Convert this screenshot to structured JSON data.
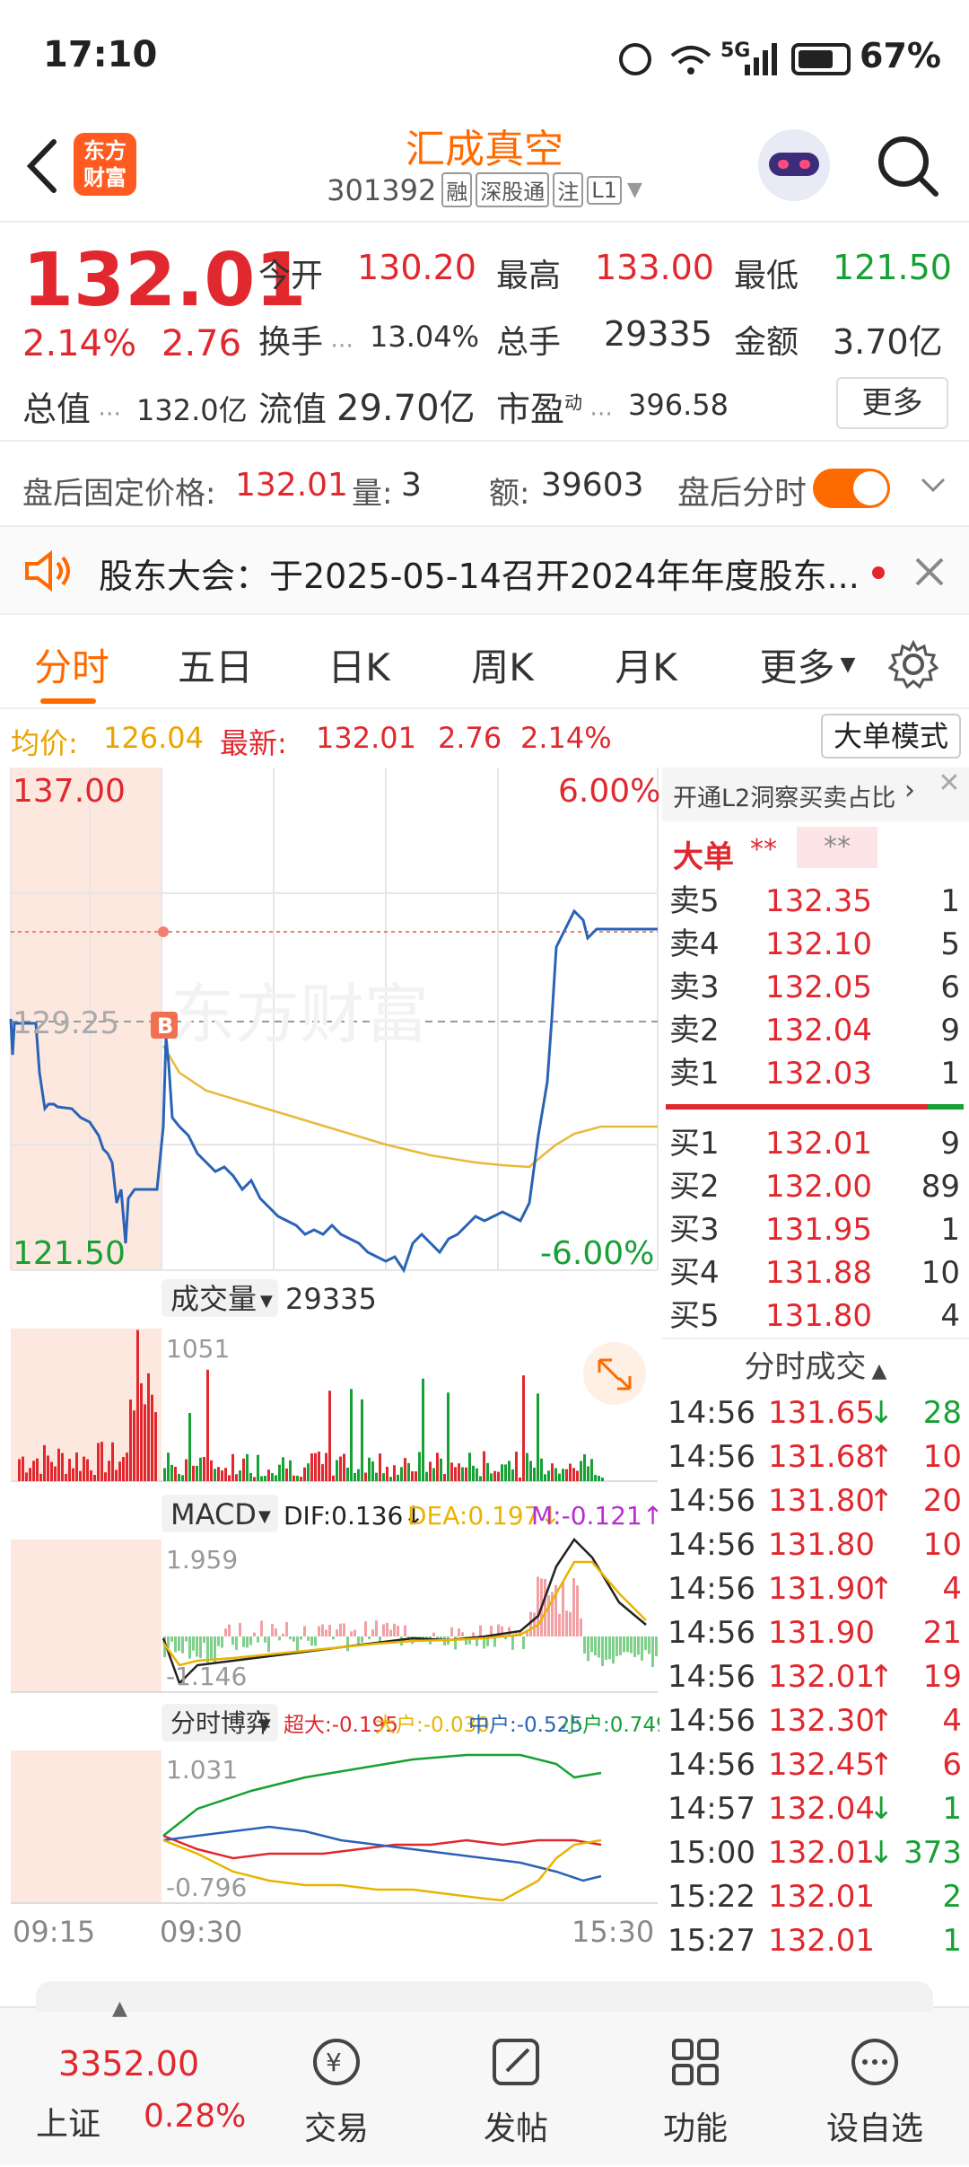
{
  "status_bar": {
    "time": "17:10",
    "battery": "67%",
    "network": "5G"
  },
  "header": {
    "stock_name": "汇成真空",
    "stock_code": "301392",
    "tags": [
      "融",
      "深股通",
      "注",
      "L1"
    ],
    "logo_text": "东方财富",
    "icons": [
      "back-arrow-icon",
      "robot-avatar-icon",
      "search-icon"
    ]
  },
  "quote": {
    "price": "132.01",
    "change_pct": "2.14%",
    "change": "2.76",
    "open_label": "今开",
    "open": "130.20",
    "high_label": "最高",
    "high": "133.00",
    "low_label": "最低",
    "low": "121.50",
    "turnover_label": "换手",
    "turnover": "13.04%",
    "volume_label": "总手",
    "volume": "29335",
    "amount_label": "金额",
    "amount": "3.70亿",
    "mktcap_label": "总值",
    "mktcap": "132.0亿",
    "float_label": "流值",
    "float": "29.70亿",
    "pe_label": "市盈",
    "pe_sup": "动",
    "pe": "396.58",
    "more_label": "更多"
  },
  "after_hours": {
    "price_label": "盘后固定价格:",
    "price": "132.01",
    "qty_label": "量:",
    "qty": "3",
    "amount_label": "额:",
    "amount": "39603",
    "toggle_label": "盘后分时"
  },
  "notice": {
    "text": "股东大会：于2025-05-14召开2024年年度股东..."
  },
  "tabs": [
    "分时",
    "五日",
    "日K",
    "周K",
    "月K",
    "更多"
  ],
  "info_bar": {
    "avg_label": "均价:",
    "avg": "126.04",
    "latest_label": "最新:",
    "latest": "132.01",
    "change": "2.76",
    "change_pct": "2.14%",
    "mode_button": "大单模式"
  },
  "price_chart": {
    "y_top": "137.00",
    "y_mid": "129.25",
    "y_bottom": "121.50",
    "pct_top": "6.00%",
    "pct_bottom": "-6.00%",
    "watermark": "东方财富",
    "marker": "B"
  },
  "volume_panel": {
    "label": "成交量",
    "total": "29335",
    "max": "1051"
  },
  "macd_panel": {
    "label": "MACD",
    "dif": "DIF:0.136↓",
    "dea": "DEA:0.197↓",
    "m": "M:-0.121↑",
    "max": "1.959",
    "min": "-1.146"
  },
  "game_panel": {
    "label": "分时博弈",
    "super": "超大:-0.195",
    "big": "大户:-0.030",
    "mid": "中户:-0.525",
    "small": "小户:0.749",
    "max": "1.031",
    "min": "-0.796"
  },
  "time_axis": {
    "t0": "09:15",
    "t1": "09:30",
    "t2": "15:30"
  },
  "orderbook": {
    "l2_text": "开通L2洞察买卖占比",
    "big_label": "大单",
    "masked": "**",
    "masked2": "**",
    "asks": [
      {
        "label": "卖5",
        "price": "132.35",
        "qty": "1"
      },
      {
        "label": "卖4",
        "price": "132.10",
        "qty": "5"
      },
      {
        "label": "卖3",
        "price": "132.05",
        "qty": "6"
      },
      {
        "label": "卖2",
        "price": "132.04",
        "qty": "9"
      },
      {
        "label": "卖1",
        "price": "132.03",
        "qty": "1"
      }
    ],
    "bids": [
      {
        "label": "买1",
        "price": "132.01",
        "qty": "9"
      },
      {
        "label": "买2",
        "price": "132.00",
        "qty": "89"
      },
      {
        "label": "买3",
        "price": "131.95",
        "qty": "1"
      },
      {
        "label": "买4",
        "price": "131.88",
        "qty": "10"
      },
      {
        "label": "买5",
        "price": "131.80",
        "qty": "4"
      }
    ],
    "trades_title": "分时成交",
    "trades": [
      {
        "time": "14:56",
        "price": "131.65",
        "dir": "↓",
        "qty": "28",
        "color": "#e0282e",
        "qcolor": "#17a034"
      },
      {
        "time": "14:56",
        "price": "131.68",
        "dir": "↑",
        "qty": "10",
        "color": "#e0282e",
        "qcolor": "#e0282e"
      },
      {
        "time": "14:56",
        "price": "131.80",
        "dir": "↑",
        "qty": "20",
        "color": "#e0282e",
        "qcolor": "#e0282e"
      },
      {
        "time": "14:56",
        "price": "131.80",
        "dir": "",
        "qty": "10",
        "color": "#e0282e",
        "qcolor": "#e0282e"
      },
      {
        "time": "14:56",
        "price": "131.90",
        "dir": "↑",
        "qty": "4",
        "color": "#e0282e",
        "qcolor": "#e0282e"
      },
      {
        "time": "14:56",
        "price": "131.90",
        "dir": "",
        "qty": "21",
        "color": "#e0282e",
        "qcolor": "#e0282e"
      },
      {
        "time": "14:56",
        "price": "132.01",
        "dir": "↑",
        "qty": "19",
        "color": "#e0282e",
        "qcolor": "#e0282e"
      },
      {
        "time": "14:56",
        "price": "132.30",
        "dir": "↑",
        "qty": "4",
        "color": "#e0282e",
        "qcolor": "#e0282e"
      },
      {
        "time": "14:56",
        "price": "132.45",
        "dir": "↑",
        "qty": "6",
        "color": "#e0282e",
        "qcolor": "#e0282e"
      },
      {
        "time": "14:57",
        "price": "132.04",
        "dir": "↓",
        "qty": "1",
        "color": "#e0282e",
        "qcolor": "#17a034"
      },
      {
        "time": "15:00",
        "price": "132.01",
        "dir": "↓",
        "qty": "373",
        "color": "#e0282e",
        "qcolor": "#17a034"
      },
      {
        "time": "15:22",
        "price": "132.01",
        "dir": "",
        "qty": "2",
        "color": "#e0282e",
        "qcolor": "#17a034"
      },
      {
        "time": "15:27",
        "price": "132.01",
        "dir": "",
        "qty": "1",
        "color": "#e0282e",
        "qcolor": "#17a034"
      }
    ]
  },
  "bottom_nav": {
    "index_value": "3352.00",
    "index_name": "上证",
    "index_change": "0.28%",
    "items": [
      "交易",
      "发帖",
      "功能",
      "设自选"
    ]
  },
  "colors": {
    "up": "#e0282e",
    "down": "#17a034",
    "accent": "#ff6a00",
    "price_line": "#2a63b5",
    "avg_line": "#e9b93b"
  }
}
